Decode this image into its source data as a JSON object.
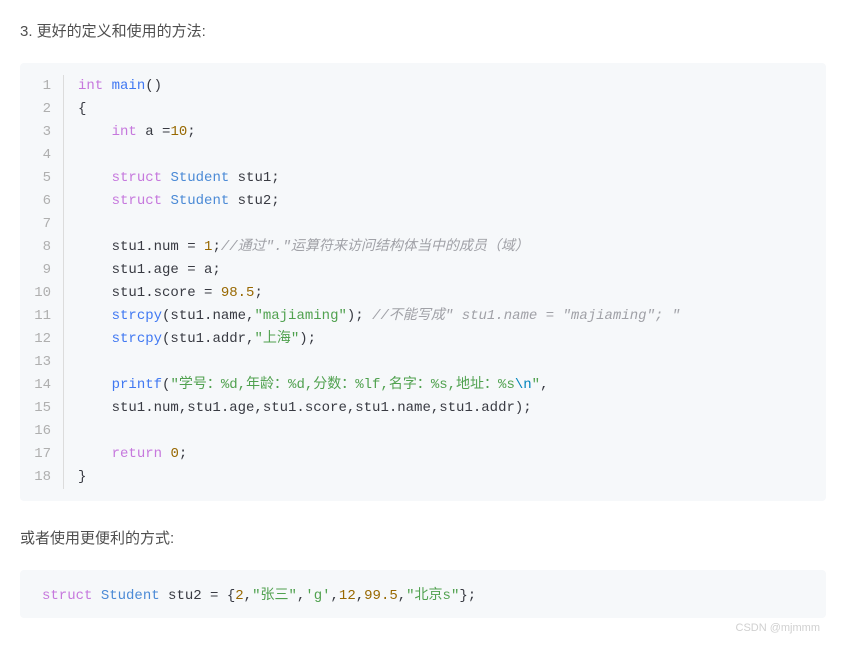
{
  "heading": "3. 更好的定义和使用的方法:",
  "code": {
    "lines": [
      {
        "n": "1",
        "tokens": [
          {
            "cls": "t-keyword",
            "text": "int"
          },
          {
            "cls": "t-plain",
            "text": " "
          },
          {
            "cls": "t-func",
            "text": "main"
          },
          {
            "cls": "t-plain",
            "text": "()"
          }
        ]
      },
      {
        "n": "2",
        "tokens": [
          {
            "cls": "t-plain",
            "text": "{"
          }
        ]
      },
      {
        "n": "3",
        "tokens": [
          {
            "cls": "t-plain",
            "text": "    "
          },
          {
            "cls": "t-keyword",
            "text": "int"
          },
          {
            "cls": "t-plain",
            "text": " a ="
          },
          {
            "cls": "t-num",
            "text": "10"
          },
          {
            "cls": "t-plain",
            "text": ";"
          }
        ]
      },
      {
        "n": "4",
        "tokens": []
      },
      {
        "n": "5",
        "tokens": [
          {
            "cls": "t-plain",
            "text": "    "
          },
          {
            "cls": "t-keyword",
            "text": "struct"
          },
          {
            "cls": "t-plain",
            "text": " "
          },
          {
            "cls": "t-type",
            "text": "Student"
          },
          {
            "cls": "t-plain",
            "text": " stu1;"
          }
        ]
      },
      {
        "n": "6",
        "tokens": [
          {
            "cls": "t-plain",
            "text": "    "
          },
          {
            "cls": "t-keyword",
            "text": "struct"
          },
          {
            "cls": "t-plain",
            "text": " "
          },
          {
            "cls": "t-type",
            "text": "Student"
          },
          {
            "cls": "t-plain",
            "text": " stu2;"
          }
        ]
      },
      {
        "n": "7",
        "tokens": []
      },
      {
        "n": "8",
        "tokens": [
          {
            "cls": "t-plain",
            "text": "    stu1.num = "
          },
          {
            "cls": "t-num",
            "text": "1"
          },
          {
            "cls": "t-plain",
            "text": ";"
          },
          {
            "cls": "t-comment",
            "text": "//通过\".\"运算符来访问结构体当中的成员（域）"
          }
        ]
      },
      {
        "n": "9",
        "tokens": [
          {
            "cls": "t-plain",
            "text": "    stu1.age = a;"
          }
        ]
      },
      {
        "n": "10",
        "tokens": [
          {
            "cls": "t-plain",
            "text": "    stu1.score = "
          },
          {
            "cls": "t-num",
            "text": "98.5"
          },
          {
            "cls": "t-plain",
            "text": ";"
          }
        ]
      },
      {
        "n": "11",
        "tokens": [
          {
            "cls": "t-plain",
            "text": "    "
          },
          {
            "cls": "t-func",
            "text": "strcpy"
          },
          {
            "cls": "t-plain",
            "text": "(stu1.name,"
          },
          {
            "cls": "t-str",
            "text": "\"majiaming\""
          },
          {
            "cls": "t-plain",
            "text": "); "
          },
          {
            "cls": "t-comment",
            "text": "//不能写成\" stu1.name = \"majiaming\"; \""
          }
        ]
      },
      {
        "n": "12",
        "tokens": [
          {
            "cls": "t-plain",
            "text": "    "
          },
          {
            "cls": "t-func",
            "text": "strcpy"
          },
          {
            "cls": "t-plain",
            "text": "(stu1.addr,"
          },
          {
            "cls": "t-str",
            "text": "\"上海\""
          },
          {
            "cls": "t-plain",
            "text": ");"
          }
        ]
      },
      {
        "n": "13",
        "tokens": []
      },
      {
        "n": "14",
        "tokens": [
          {
            "cls": "t-plain",
            "text": "    "
          },
          {
            "cls": "t-func",
            "text": "printf"
          },
          {
            "cls": "t-plain",
            "text": "("
          },
          {
            "cls": "t-str",
            "text": "\"学号：%d,年龄：%d,分数：%lf,名字：%s,地址：%s"
          },
          {
            "cls": "t-escape",
            "text": "\\n"
          },
          {
            "cls": "t-str",
            "text": "\""
          },
          {
            "cls": "t-plain",
            "text": ","
          }
        ]
      },
      {
        "n": "15",
        "tokens": [
          {
            "cls": "t-plain",
            "text": "    stu1.num,stu1.age,stu1.score,stu1.name,stu1.addr);"
          }
        ]
      },
      {
        "n": "16",
        "tokens": []
      },
      {
        "n": "17",
        "tokens": [
          {
            "cls": "t-plain",
            "text": "    "
          },
          {
            "cls": "t-keyword",
            "text": "return"
          },
          {
            "cls": "t-plain",
            "text": " "
          },
          {
            "cls": "t-num",
            "text": "0"
          },
          {
            "cls": "t-plain",
            "text": ";"
          }
        ]
      },
      {
        "n": "18",
        "tokens": [
          {
            "cls": "t-plain",
            "text": "}"
          }
        ]
      }
    ]
  },
  "subtext": "或者使用更便利的方式:",
  "inline_code": {
    "tokens": [
      {
        "cls": "t-keyword",
        "text": "struct"
      },
      {
        "cls": "t-plain",
        "text": " "
      },
      {
        "cls": "t-type",
        "text": "Student"
      },
      {
        "cls": "t-plain",
        "text": " stu2 = {"
      },
      {
        "cls": "t-num",
        "text": "2"
      },
      {
        "cls": "t-plain",
        "text": ","
      },
      {
        "cls": "t-str",
        "text": "\"张三\""
      },
      {
        "cls": "t-plain",
        "text": ","
      },
      {
        "cls": "t-char",
        "text": "'g'"
      },
      {
        "cls": "t-plain",
        "text": ","
      },
      {
        "cls": "t-num",
        "text": "12"
      },
      {
        "cls": "t-plain",
        "text": ","
      },
      {
        "cls": "t-num",
        "text": "99.5"
      },
      {
        "cls": "t-plain",
        "text": ","
      },
      {
        "cls": "t-str",
        "text": "\"北京s\""
      },
      {
        "cls": "t-plain",
        "text": "};"
      }
    ]
  },
  "watermark": "CSDN @mjmmm"
}
